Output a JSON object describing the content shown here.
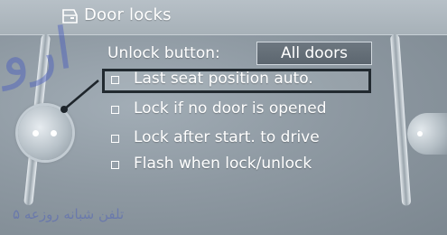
{
  "header": {
    "title": "Door locks",
    "icon": "car-door-icon"
  },
  "settings": {
    "unlock_label": "Unlock button:",
    "unlock_value": "All doors",
    "items": [
      {
        "label": "Last seat position auto.",
        "checked": false,
        "selected": true
      },
      {
        "label": "Lock if no door is opened",
        "checked": false,
        "selected": false
      },
      {
        "label": "Lock after start. to drive",
        "checked": false,
        "selected": false
      },
      {
        "label": "Flash when lock/unlock",
        "checked": false,
        "selected": false
      }
    ]
  },
  "watermark": {
    "logo_text": "ﺍﺭﻭ",
    "phone_text": "ﺗﻠﻔﻦ ﺷﺒﺎﻧﻪ ﺭﻭﺯﻋﻪ ۵"
  }
}
